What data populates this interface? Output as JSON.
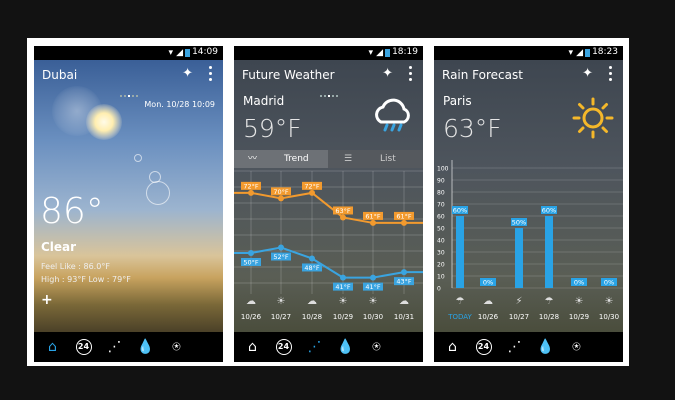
{
  "phones": [
    {
      "status_time": "14:09",
      "title": "Dubai",
      "date": "Mon. 10/28 10:09",
      "temp": "86°",
      "condition": "Clear",
      "feels": "Feel Like : 86.0°F",
      "hilo": "High : 93°F   Low : 79°F",
      "plus": "+"
    },
    {
      "status_time": "18:19",
      "title": "Future Weather",
      "city": "Madrid",
      "temp": "59°F",
      "tabs": {
        "trend": "Trend",
        "list": "List"
      },
      "days": [
        "10/26",
        "10/27",
        "10/28",
        "10/29",
        "10/30",
        "10/31"
      ],
      "chart_data": {
        "type": "line",
        "categories": [
          "10/26",
          "10/27",
          "10/28",
          "10/29",
          "10/30",
          "10/31"
        ],
        "series": [
          {
            "values": [
              72,
              70,
              72,
              63,
              61,
              61
            ]
          },
          {
            "values": [
              50,
              52,
              48,
              41,
              41,
              43
            ]
          }
        ],
        "data_labels_high": [
          "72°F",
          "70°F",
          "72°F",
          "63°F",
          "61°F",
          "61°F"
        ],
        "data_labels_low": [
          "50°F",
          "52°F",
          "48°F",
          "41°F",
          "41°F",
          "43°F"
        ],
        "ylim": [
          35,
          80
        ],
        "grid": true
      }
    },
    {
      "status_time": "18:23",
      "title": "Rain Forecast",
      "city": "Paris",
      "temp": "63°F",
      "days": [
        "TODAY",
        "10/26",
        "10/27",
        "10/28",
        "10/29",
        "10/30"
      ],
      "chart_data": {
        "type": "bar",
        "categories": [
          "TODAY",
          "10/26",
          "10/27",
          "10/28",
          "10/29",
          "10/30"
        ],
        "values": [
          60,
          0,
          50,
          60,
          0,
          0
        ],
        "data_labels": [
          "60%",
          "0%",
          "50%",
          "60%",
          "0%",
          "0%"
        ],
        "yticks": [
          "100",
          "90",
          "80",
          "70",
          "60",
          "50",
          "40",
          "30",
          "20",
          "10",
          "0"
        ],
        "ylim": [
          0,
          100
        ],
        "grid": true
      }
    }
  ],
  "nav_badge": "24",
  "colors": {
    "accent": "#29a3e6",
    "high_line": "#f29a2e",
    "low_line": "#3aa4e0"
  }
}
